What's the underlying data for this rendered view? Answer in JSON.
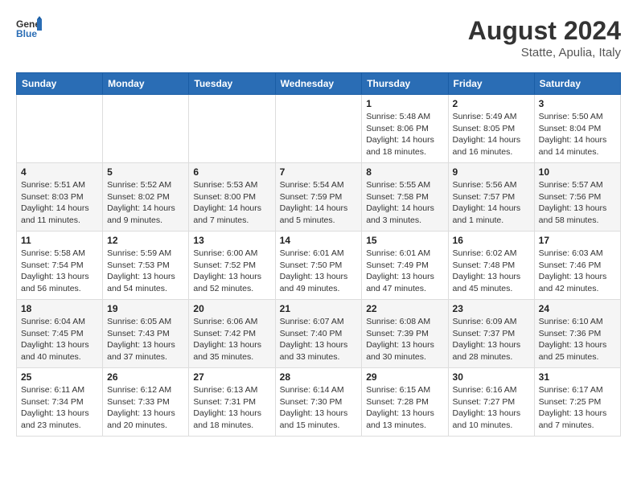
{
  "header": {
    "logo": {
      "general": "General",
      "blue": "Blue"
    },
    "title": "August 2024",
    "subtitle": "Statte, Apulia, Italy"
  },
  "days_of_week": [
    "Sunday",
    "Monday",
    "Tuesday",
    "Wednesday",
    "Thursday",
    "Friday",
    "Saturday"
  ],
  "weeks": [
    [
      {
        "day": "",
        "info": ""
      },
      {
        "day": "",
        "info": ""
      },
      {
        "day": "",
        "info": ""
      },
      {
        "day": "",
        "info": ""
      },
      {
        "day": "1",
        "info": "Sunrise: 5:48 AM\nSunset: 8:06 PM\nDaylight: 14 hours\nand 18 minutes."
      },
      {
        "day": "2",
        "info": "Sunrise: 5:49 AM\nSunset: 8:05 PM\nDaylight: 14 hours\nand 16 minutes."
      },
      {
        "day": "3",
        "info": "Sunrise: 5:50 AM\nSunset: 8:04 PM\nDaylight: 14 hours\nand 14 minutes."
      }
    ],
    [
      {
        "day": "4",
        "info": "Sunrise: 5:51 AM\nSunset: 8:03 PM\nDaylight: 14 hours\nand 11 minutes."
      },
      {
        "day": "5",
        "info": "Sunrise: 5:52 AM\nSunset: 8:02 PM\nDaylight: 14 hours\nand 9 minutes."
      },
      {
        "day": "6",
        "info": "Sunrise: 5:53 AM\nSunset: 8:00 PM\nDaylight: 14 hours\nand 7 minutes."
      },
      {
        "day": "7",
        "info": "Sunrise: 5:54 AM\nSunset: 7:59 PM\nDaylight: 14 hours\nand 5 minutes."
      },
      {
        "day": "8",
        "info": "Sunrise: 5:55 AM\nSunset: 7:58 PM\nDaylight: 14 hours\nand 3 minutes."
      },
      {
        "day": "9",
        "info": "Sunrise: 5:56 AM\nSunset: 7:57 PM\nDaylight: 14 hours\nand 1 minute."
      },
      {
        "day": "10",
        "info": "Sunrise: 5:57 AM\nSunset: 7:56 PM\nDaylight: 13 hours\nand 58 minutes."
      }
    ],
    [
      {
        "day": "11",
        "info": "Sunrise: 5:58 AM\nSunset: 7:54 PM\nDaylight: 13 hours\nand 56 minutes."
      },
      {
        "day": "12",
        "info": "Sunrise: 5:59 AM\nSunset: 7:53 PM\nDaylight: 13 hours\nand 54 minutes."
      },
      {
        "day": "13",
        "info": "Sunrise: 6:00 AM\nSunset: 7:52 PM\nDaylight: 13 hours\nand 52 minutes."
      },
      {
        "day": "14",
        "info": "Sunrise: 6:01 AM\nSunset: 7:50 PM\nDaylight: 13 hours\nand 49 minutes."
      },
      {
        "day": "15",
        "info": "Sunrise: 6:01 AM\nSunset: 7:49 PM\nDaylight: 13 hours\nand 47 minutes."
      },
      {
        "day": "16",
        "info": "Sunrise: 6:02 AM\nSunset: 7:48 PM\nDaylight: 13 hours\nand 45 minutes."
      },
      {
        "day": "17",
        "info": "Sunrise: 6:03 AM\nSunset: 7:46 PM\nDaylight: 13 hours\nand 42 minutes."
      }
    ],
    [
      {
        "day": "18",
        "info": "Sunrise: 6:04 AM\nSunset: 7:45 PM\nDaylight: 13 hours\nand 40 minutes."
      },
      {
        "day": "19",
        "info": "Sunrise: 6:05 AM\nSunset: 7:43 PM\nDaylight: 13 hours\nand 37 minutes."
      },
      {
        "day": "20",
        "info": "Sunrise: 6:06 AM\nSunset: 7:42 PM\nDaylight: 13 hours\nand 35 minutes."
      },
      {
        "day": "21",
        "info": "Sunrise: 6:07 AM\nSunset: 7:40 PM\nDaylight: 13 hours\nand 33 minutes."
      },
      {
        "day": "22",
        "info": "Sunrise: 6:08 AM\nSunset: 7:39 PM\nDaylight: 13 hours\nand 30 minutes."
      },
      {
        "day": "23",
        "info": "Sunrise: 6:09 AM\nSunset: 7:37 PM\nDaylight: 13 hours\nand 28 minutes."
      },
      {
        "day": "24",
        "info": "Sunrise: 6:10 AM\nSunset: 7:36 PM\nDaylight: 13 hours\nand 25 minutes."
      }
    ],
    [
      {
        "day": "25",
        "info": "Sunrise: 6:11 AM\nSunset: 7:34 PM\nDaylight: 13 hours\nand 23 minutes."
      },
      {
        "day": "26",
        "info": "Sunrise: 6:12 AM\nSunset: 7:33 PM\nDaylight: 13 hours\nand 20 minutes."
      },
      {
        "day": "27",
        "info": "Sunrise: 6:13 AM\nSunset: 7:31 PM\nDaylight: 13 hours\nand 18 minutes."
      },
      {
        "day": "28",
        "info": "Sunrise: 6:14 AM\nSunset: 7:30 PM\nDaylight: 13 hours\nand 15 minutes."
      },
      {
        "day": "29",
        "info": "Sunrise: 6:15 AM\nSunset: 7:28 PM\nDaylight: 13 hours\nand 13 minutes."
      },
      {
        "day": "30",
        "info": "Sunrise: 6:16 AM\nSunset: 7:27 PM\nDaylight: 13 hours\nand 10 minutes."
      },
      {
        "day": "31",
        "info": "Sunrise: 6:17 AM\nSunset: 7:25 PM\nDaylight: 13 hours\nand 7 minutes."
      }
    ]
  ]
}
